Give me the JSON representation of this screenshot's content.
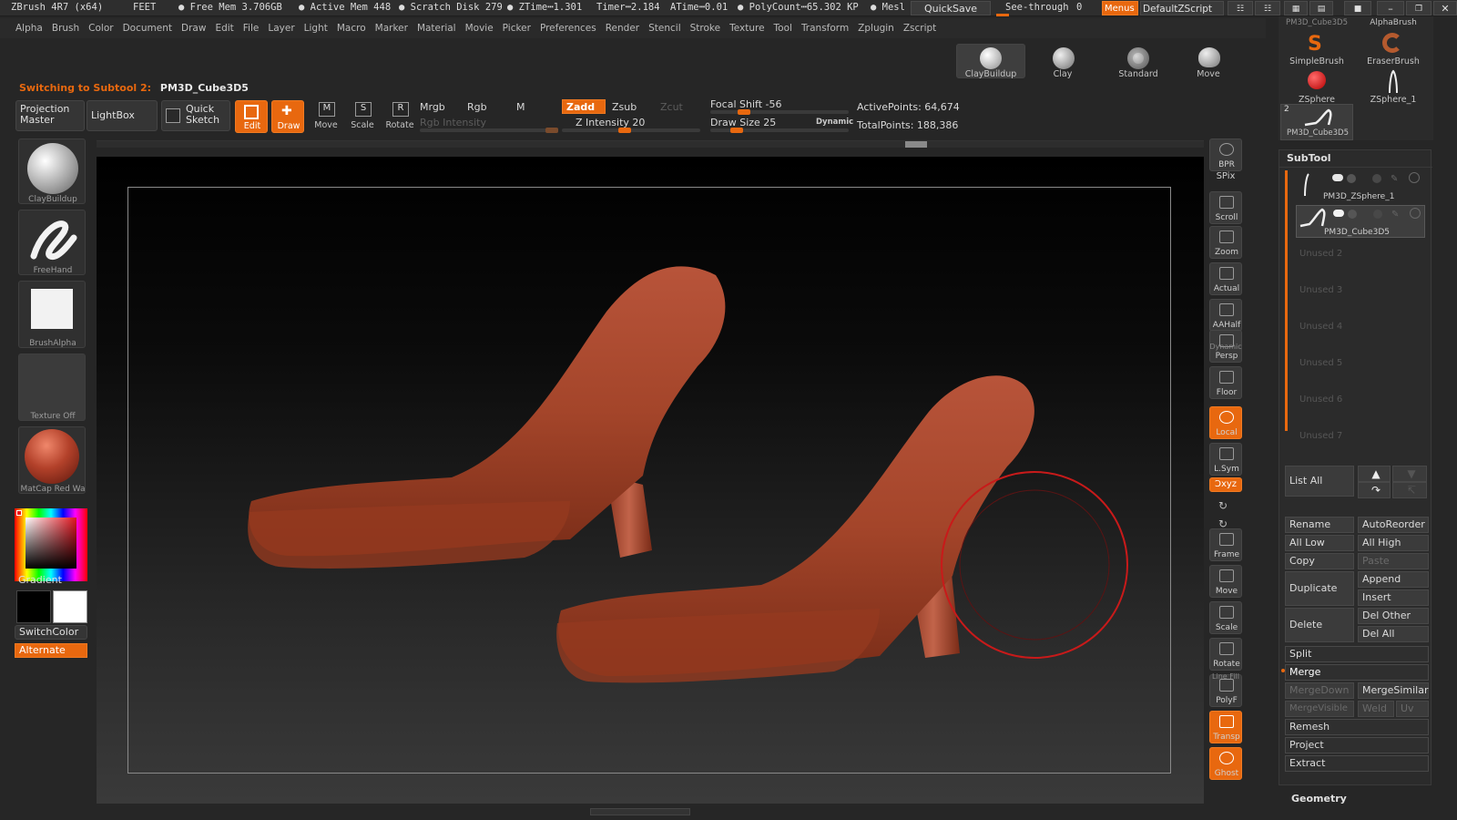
{
  "titlebar": {
    "app": "ZBrush 4R7 (x64)",
    "units": "FEET",
    "free_mem": "● Free Mem 3.706GB",
    "active_mem": "● Active Mem 448",
    "scratch_disk": "● Scratch Disk 279",
    "ztime": "● ZTime┅1.301",
    "timer": "Timer┅2.184",
    "atime": "ATime┅0.01",
    "polycount": "● PolyCount┅65.302 KP",
    "mesh": "● Mesl",
    "quicksave": "QuickSave",
    "seethrough": "See-through",
    "seethrough_val": "0",
    "menus": "Menus",
    "script": "DefaultZScript"
  },
  "menubar": [
    "Alpha",
    "Brush",
    "Color",
    "Document",
    "Draw",
    "Edit",
    "File",
    "Layer",
    "Light",
    "Macro",
    "Marker",
    "Material",
    "Movie",
    "Picker",
    "Preferences",
    "Render",
    "Stencil",
    "Stroke",
    "Texture",
    "Tool",
    "Transform",
    "Zplugin",
    "Zscript"
  ],
  "status": {
    "prefix": "Switching to Subtool 2:",
    "name": "PM3D_Cube3D5"
  },
  "brush_shelf": [
    "ClayBuildup",
    "Clay",
    "Standard",
    "Move"
  ],
  "toolbar": {
    "projection_master": "Projection Master",
    "lightbox": "LightBox",
    "quick_sketch": "Quick Sketch",
    "edit": "Edit",
    "draw": "Draw",
    "move": "Move",
    "scale": "Scale",
    "rotate": "Rotate",
    "mrgb": "Mrgb",
    "rgb": "Rgb",
    "m": "M",
    "rgb_intensity": "Rgb Intensity",
    "zadd": "Zadd",
    "zsub": "Zsub",
    "zcut": "Zcut",
    "z_intensity": "Z Intensity 20",
    "z_intensity_value": 20,
    "focal_shift": "Focal Shift -56",
    "focal_shift_value": -56,
    "draw_size": "Draw Size 25",
    "draw_size_value": 25,
    "dynamic": "Dynamic",
    "active_points": "ActivePoints: 64,674",
    "total_points": "TotalPoints: 188,386"
  },
  "lefttray": {
    "brush": "ClayBuildup",
    "stroke": "FreeHand",
    "alpha": "BrushAlpha",
    "texture": "Texture Off",
    "material": "MatCap Red Wa",
    "gradient": "Gradient",
    "switchcolor": "SwitchColor",
    "alternate": "Alternate"
  },
  "righttray": [
    "BPR",
    "SPix",
    "Scroll",
    "Zoom",
    "Actual",
    "AAHalf",
    "Persp",
    "Floor",
    "Local",
    "L.Sym",
    "Frame",
    "Move",
    "Scale",
    "Rotate",
    "PolyF",
    "Transp",
    "Ghost"
  ],
  "righttray_extra": {
    "xyz": "Ɔxyz",
    "dynamic": "Dynamic",
    "linefill": "Line Fill"
  },
  "tools_palette": {
    "items": [
      "SimpleBrush",
      "EraserBrush",
      "ZSphere",
      "ZSphere_1",
      "PM3D_Cube3D5",
      "AlphaBrush",
      "PM3D_Cube3D5"
    ],
    "count": "2"
  },
  "subtool": {
    "title": "SubTool",
    "items": [
      "PM3D_ZSphere_1",
      "PM3D_Cube3D5"
    ],
    "unused": [
      "Unused 2",
      "Unused 3",
      "Unused 4",
      "Unused 5",
      "Unused 6",
      "Unused 7"
    ],
    "list_all": "List All",
    "rename": "Rename",
    "autoreorder": "AutoReorder",
    "all_low": "All Low",
    "all_high": "All High",
    "copy": "Copy",
    "paste": "Paste",
    "duplicate": "Duplicate",
    "append": "Append",
    "insert": "Insert",
    "delete": "Delete",
    "del_other": "Del Other",
    "del_all": "Del All",
    "split": "Split",
    "merge": "Merge",
    "mergedown": "MergeDown",
    "mergesimilar": "MergeSimilar",
    "mergevisible": "MergeVisible",
    "weld": "Weld",
    "uv": "Uv",
    "remesh": "Remesh",
    "project": "Project",
    "extract": "Extract",
    "geometry": "Geometry"
  },
  "colors": {
    "accent": "#e8680f",
    "model": "#a4452a",
    "brush_cursor": "#c81a1a"
  }
}
